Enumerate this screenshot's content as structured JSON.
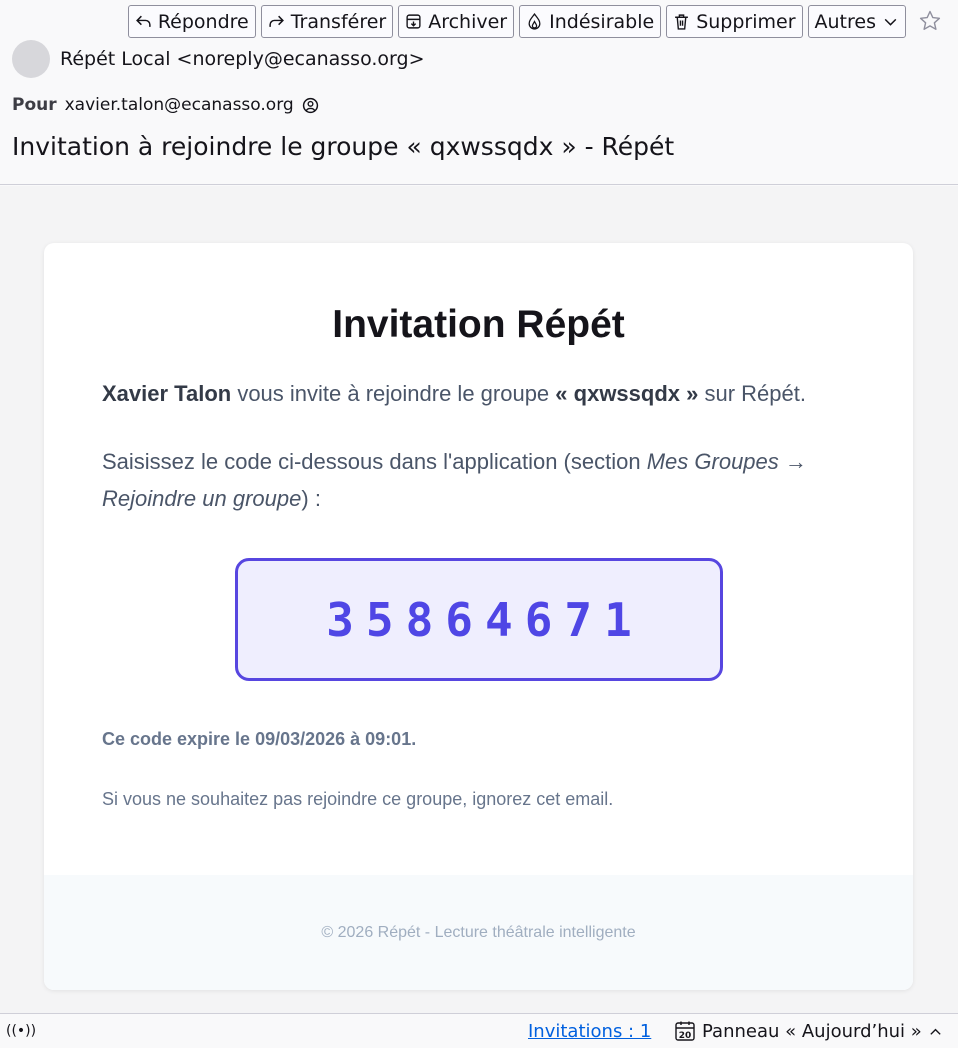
{
  "toolbar": {
    "reply": "Répondre",
    "forward": "Transférer",
    "archive": "Archiver",
    "junk": "Indésirable",
    "delete": "Supprimer",
    "more": "Autres"
  },
  "header": {
    "sender": "Répét Local <noreply@ecanasso.org>",
    "to_label": "Pour",
    "to_address": "xavier.talon@ecanasso.org",
    "subject": "Invitation à rejoindre le groupe « qxwssqdx » - Répét"
  },
  "email": {
    "title": "Invitation Répét",
    "inviter": "Xavier Talon",
    "invite_text_1": " vous invite à rejoindre le groupe ",
    "group": "« qxwssqdx »",
    "invite_text_2": " sur Répét.",
    "instruction_1": "Saisissez le code ci-dessous dans l'application (section ",
    "instruction_em": "Mes Groupes → Rejoindre un groupe",
    "instruction_2": ") :",
    "code": "35864671",
    "expires": "Ce code expire le 09/03/2026 à 09:01.",
    "ignore": "Si vous ne souhaitez pas rejoindre ce groupe, ignorez cet email.",
    "footer": "© 2026 Répét - Lecture théâtrale intelligente"
  },
  "statusbar": {
    "online_glyph": "((•))",
    "invitations": "Invitations : 1",
    "today_pane": "Panneau « Aujourd’hui »",
    "calendar_day": "20"
  },
  "colors": {
    "accent": "#4f46e5",
    "code_bg": "#efeefe",
    "link": "#0060df"
  }
}
